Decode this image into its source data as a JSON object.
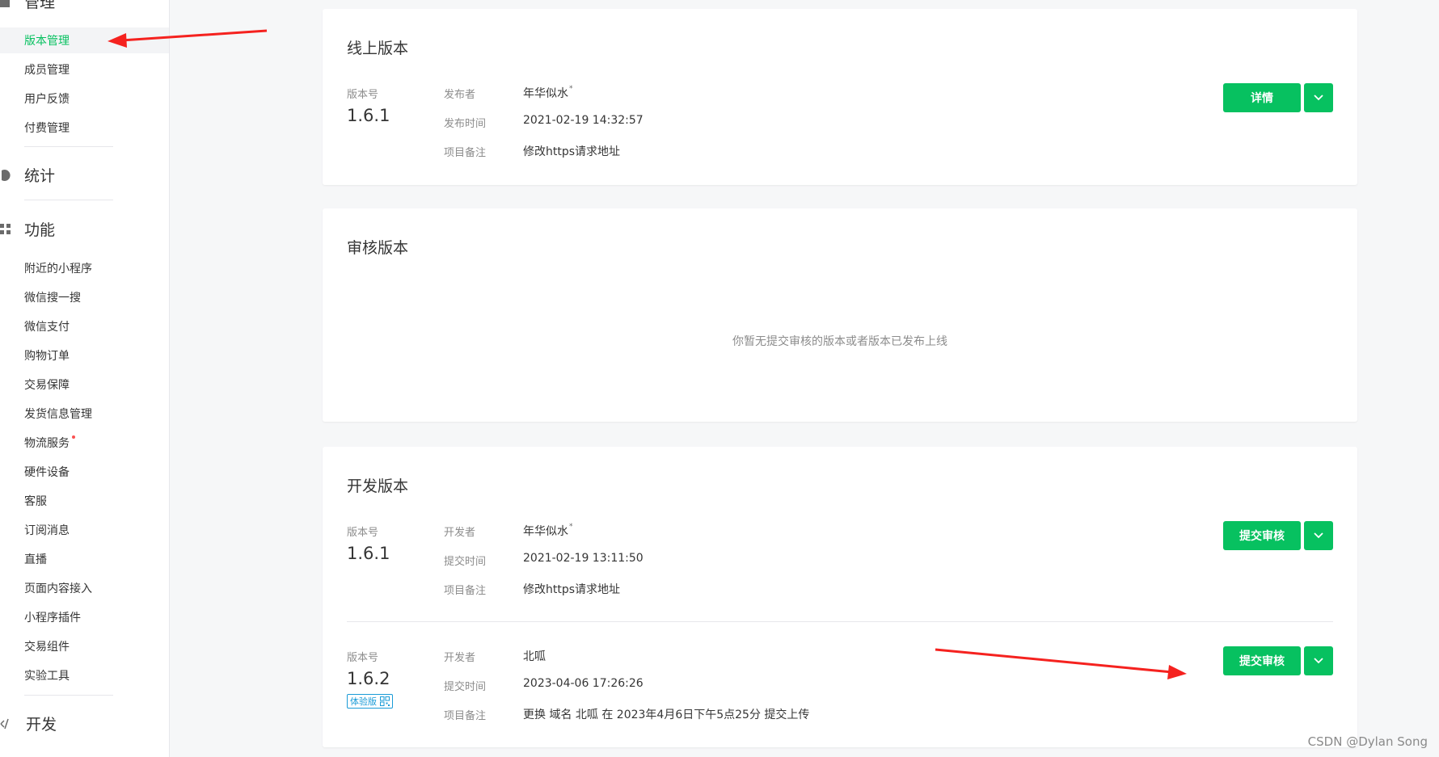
{
  "sidebar": {
    "manage_title": "管理",
    "manage_items": [
      {
        "label": "版本管理",
        "active": true
      },
      {
        "label": "成员管理"
      },
      {
        "label": "用户反馈"
      },
      {
        "label": "付费管理"
      }
    ],
    "stats_title": "统计",
    "features_title": "功能",
    "feature_items": [
      {
        "label": "附近的小程序"
      },
      {
        "label": "微信搜一搜"
      },
      {
        "label": "微信支付"
      },
      {
        "label": "购物订单"
      },
      {
        "label": "交易保障"
      },
      {
        "label": "发货信息管理"
      },
      {
        "label": "物流服务",
        "dot": true
      },
      {
        "label": "硬件设备"
      },
      {
        "label": "客服"
      },
      {
        "label": "订阅消息"
      },
      {
        "label": "直播"
      },
      {
        "label": "页面内容接入"
      },
      {
        "label": "小程序插件"
      },
      {
        "label": "交易组件"
      },
      {
        "label": "实验工具"
      }
    ],
    "dev_title": "开发"
  },
  "online": {
    "title": "线上版本",
    "version_label": "版本号",
    "version": "1.6.1",
    "publisher_label": "发布者",
    "publisher": "年华似水",
    "publisher_mark": "*",
    "time_label": "发布时间",
    "time": "2021-02-19 14:32:57",
    "note_label": "项目备注",
    "note": "修改https请求地址",
    "button": "详情"
  },
  "review": {
    "title": "审核版本",
    "empty": "你暂无提交审核的版本或者版本已发布上线"
  },
  "dev": {
    "title": "开发版本",
    "rows": [
      {
        "version_label": "版本号",
        "version": "1.6.1",
        "developer_label": "开发者",
        "developer": "年华似水",
        "developer_mark": "*",
        "time_label": "提交时间",
        "time": "2021-02-19 13:11:50",
        "note_label": "项目备注",
        "note": "修改https请求地址",
        "button": "提交审核"
      },
      {
        "version_label": "版本号",
        "version": "1.6.2",
        "badge": "体验版",
        "developer_label": "开发者",
        "developer": "北呱",
        "time_label": "提交时间",
        "time": "2023-04-06 17:26:26",
        "note_label": "项目备注",
        "note": "更换 域名 北呱 在 2023年4月6日下午5点25分 提交上传",
        "button": "提交审核"
      }
    ]
  },
  "watermark": "CSDN @Dylan  Song",
  "colors": {
    "accent": "#07c160",
    "annotation_arrow": "#f5221f",
    "badge": "#1a9bd7"
  }
}
